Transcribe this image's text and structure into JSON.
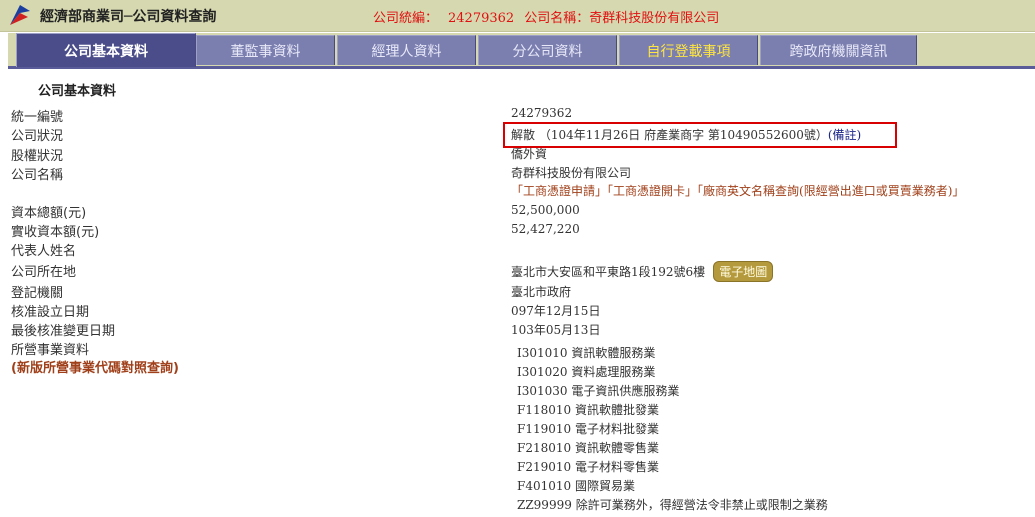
{
  "header": {
    "title": "經濟部商業司─公司資料查詢",
    "id_label": "公司統編：",
    "id_value": "24279362",
    "name_label": "公司名稱：",
    "name_value": "奇群科技股份有限公司"
  },
  "tabs": [
    {
      "label": "公司基本資料"
    },
    {
      "label": "董監事資料"
    },
    {
      "label": "經理人資料"
    },
    {
      "label": "分公司資料"
    },
    {
      "label": "自行登載事項"
    },
    {
      "label": "跨政府機關資訊"
    }
  ],
  "section_title": "公司基本資料",
  "fields": {
    "uniform_no": {
      "label": "統一編號",
      "value": "24279362"
    },
    "status": {
      "label": "公司狀況",
      "value": "解散 （104年11月26日 府產業商字 第10490552600號）",
      "note_link": "(備註)"
    },
    "ownership": {
      "label": "股權狀況",
      "value": "僑外資"
    },
    "company_name": {
      "label": "公司名稱",
      "value": "奇群科技股份有限公司",
      "links": [
        "「工商憑證申請」",
        "「工商憑證開卡」",
        "「廠商英文名稱查詢(限經營出進口或買賣業務者)」"
      ]
    },
    "capital_total": {
      "label": "資本總額(元)",
      "value": "52,500,000"
    },
    "capital_paid": {
      "label": "實收資本額(元)",
      "value": "52,427,220"
    },
    "representative": {
      "label": "代表人姓名",
      "value": ""
    },
    "address": {
      "label": "公司所在地",
      "value": "臺北市大安區和平東路1段192號6樓",
      "map_button": "電子地圖"
    },
    "registry": {
      "label": "登記機關",
      "value": "臺北市政府"
    },
    "approved_date": {
      "label": "核准設立日期",
      "value": "097年12月15日"
    },
    "last_change_date": {
      "label": "最後核准變更日期",
      "value": "103年05月13日"
    },
    "business": {
      "label": "所營事業資料",
      "link": "(新版所營事業代碼對照查詢)",
      "items": [
        {
          "code": "I301010",
          "name": "資訊軟體服務業"
        },
        {
          "code": "I301020",
          "name": "資料處理服務業"
        },
        {
          "code": "I301030",
          "name": "電子資訊供應服務業"
        },
        {
          "code": "F118010",
          "name": "資訊軟體批發業"
        },
        {
          "code": "F119010",
          "name": "電子材料批發業"
        },
        {
          "code": "F218010",
          "name": "資訊軟體零售業"
        },
        {
          "code": "F219010",
          "name": "電子材料零售業"
        },
        {
          "code": "F401010",
          "name": "國際貿易業"
        },
        {
          "code": "ZZ99999",
          "name": "除許可業務外，得經營法令非禁止或限制之業務"
        }
      ]
    }
  }
}
